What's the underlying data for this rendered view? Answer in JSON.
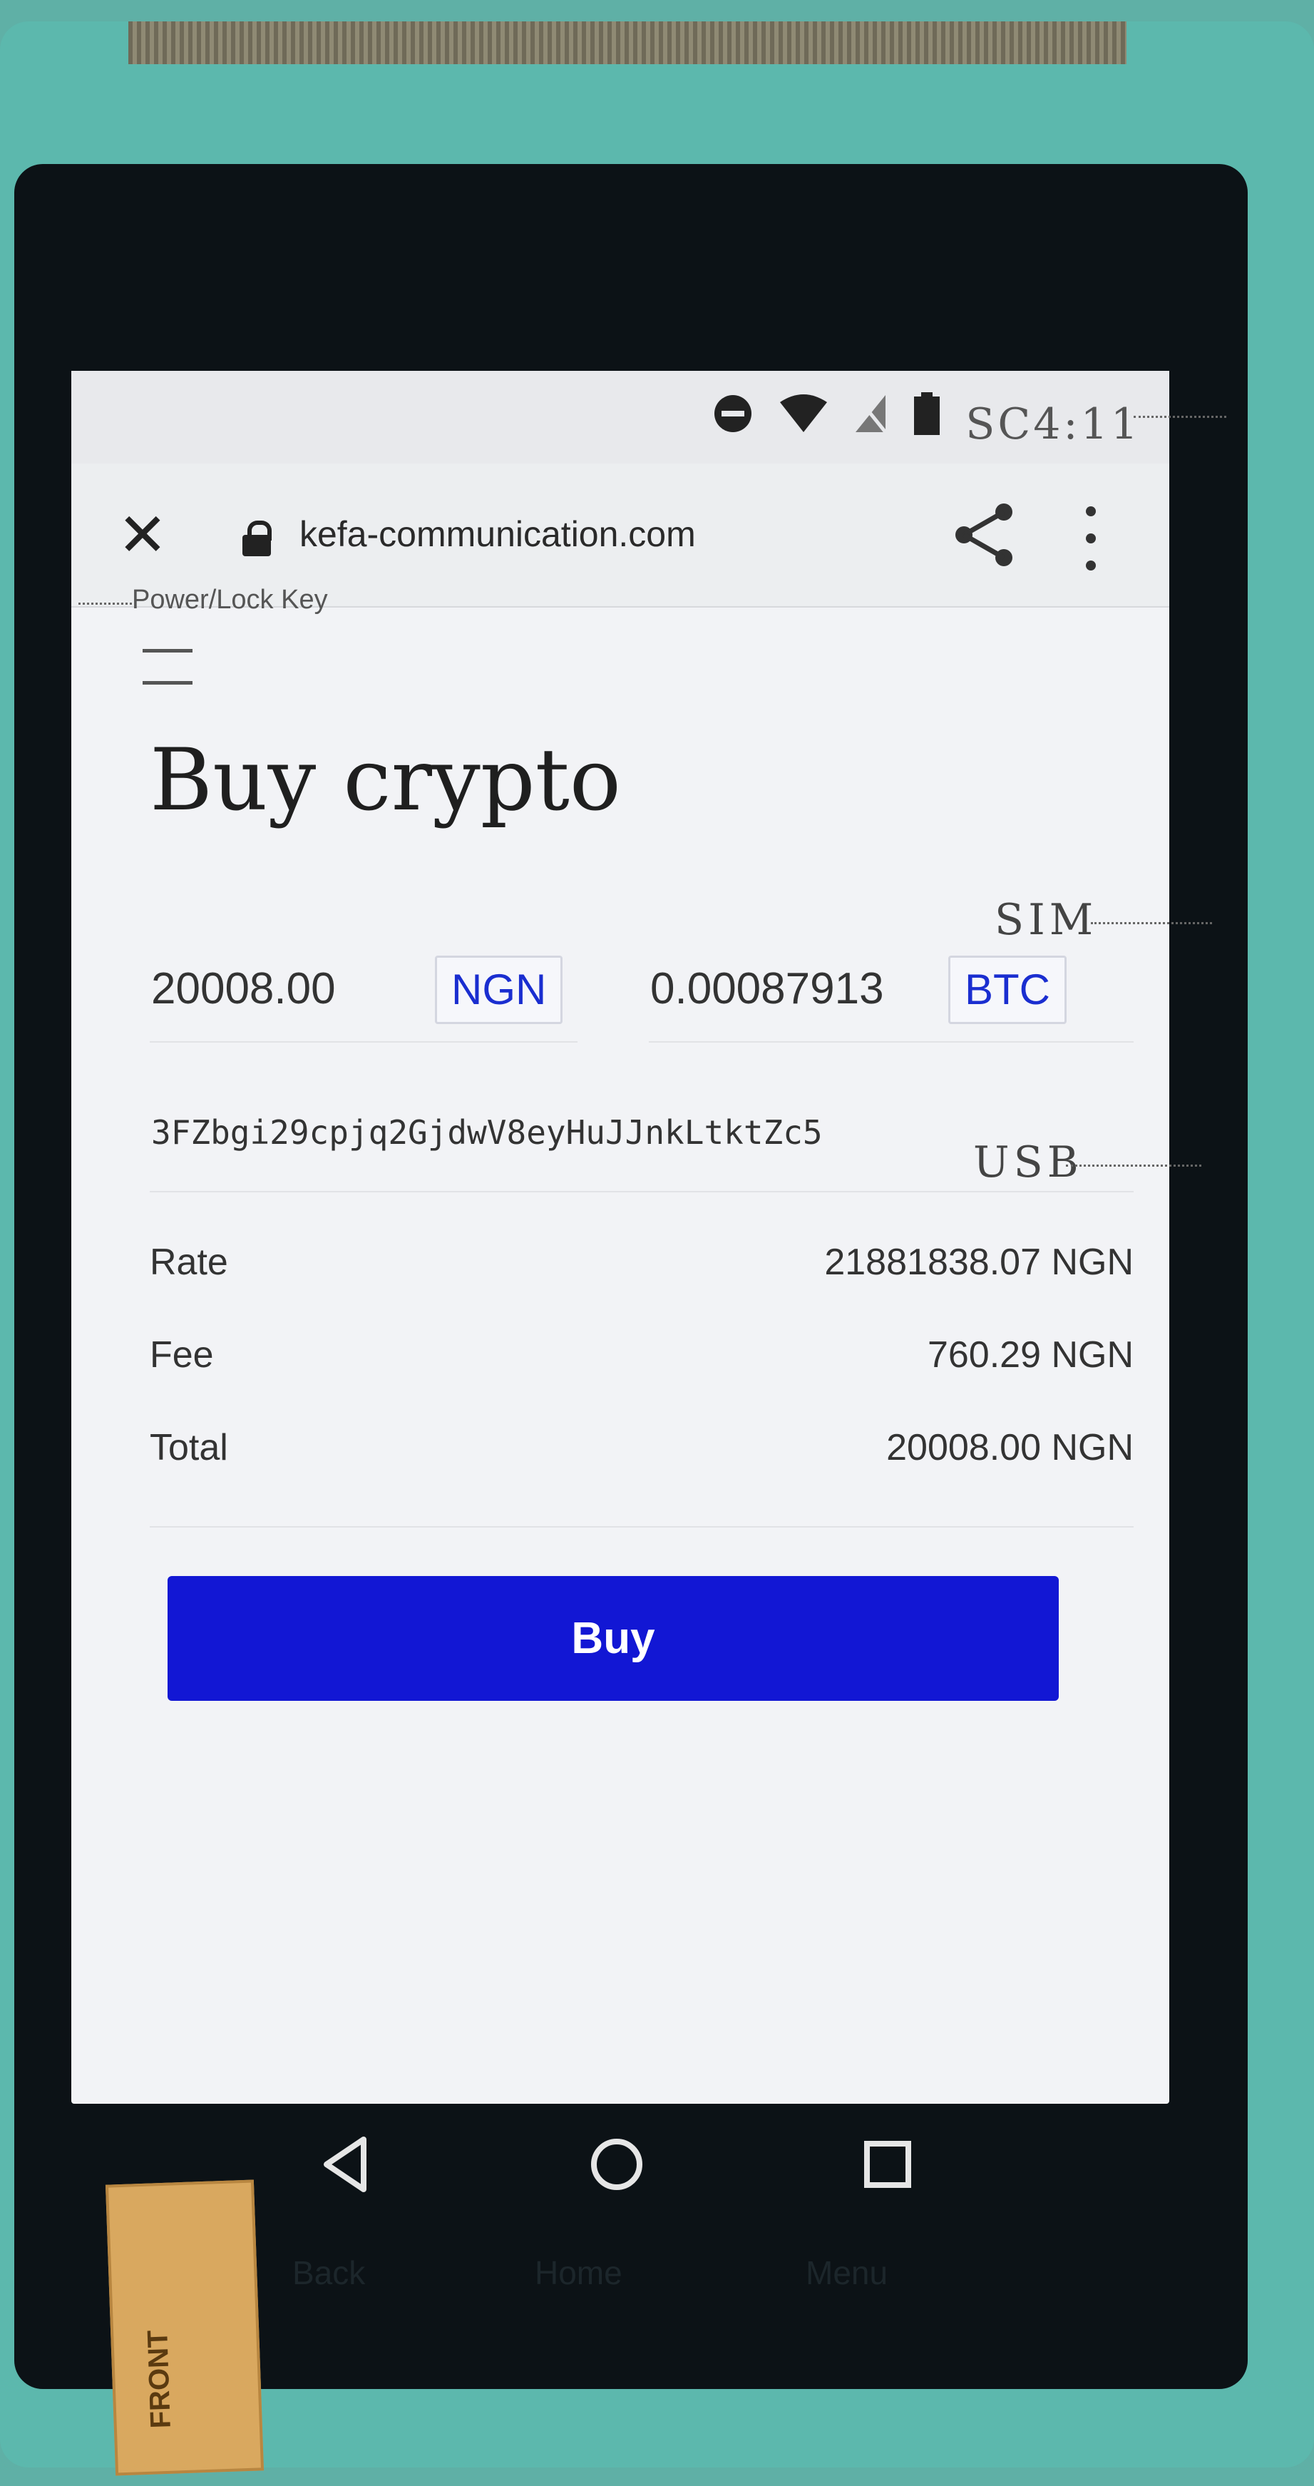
{
  "status_bar": {
    "time": "SC4:11",
    "icons": [
      "do-not-disturb-icon",
      "wifi-icon",
      "no-sim-icon",
      "battery-icon"
    ]
  },
  "browser": {
    "url": "kefa-communication.com",
    "icons": [
      "close-icon",
      "lock-icon",
      "share-icon",
      "more-vert-icon"
    ]
  },
  "page": {
    "title": "Buy crypto",
    "fiat_amount": "20008.00",
    "fiat_currency": "NGN",
    "crypto_amount": "0.00087913",
    "crypto_currency": "BTC",
    "wallet_address": "3FZbgi29cpjq2GjdwV8eyHuJJnkLtktZc5",
    "summary": [
      {
        "label": "Rate",
        "value": "21881838.07 NGN"
      },
      {
        "label": "Fee",
        "value": "760.29 NGN"
      },
      {
        "label": "Total",
        "value": "20008.00 NGN"
      }
    ],
    "buy_label": "Buy"
  },
  "device": {
    "callout_power": "Power/Lock Key",
    "callout_sim": "SIM",
    "callout_usb": "USB",
    "hw_back": "Back",
    "hw_home": "Home",
    "hw_menu": "Menu",
    "sticker_text": "FRONT"
  },
  "colors": {
    "accent": "#1217d4",
    "currency_text": "#1a2ed0"
  }
}
